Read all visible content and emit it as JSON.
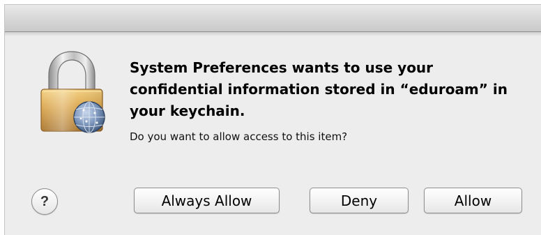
{
  "dialog": {
    "title": "System Preferences wants to use your confidential information stored in “eduroam” in your keychain.",
    "message": "Do you want to allow access to this item?",
    "icon": "keychain-lock-icon",
    "help_label": "?"
  },
  "buttons": {
    "always_allow": "Always Allow",
    "deny": "Deny",
    "allow": "Allow"
  },
  "colors": {
    "dialog_background": "#ededed",
    "lock_gold": "#d9a34a",
    "globe_blue": "#5f7fa8"
  }
}
